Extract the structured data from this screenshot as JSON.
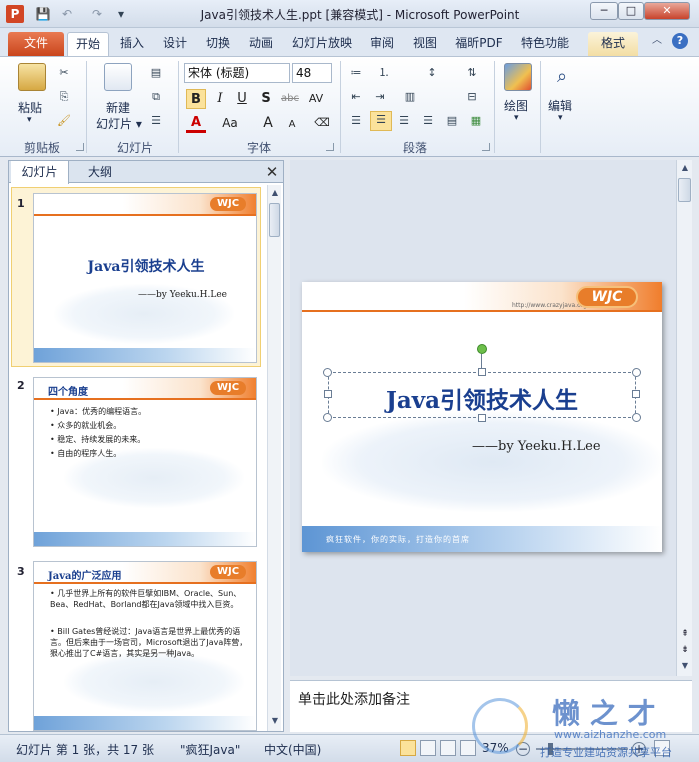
{
  "window": {
    "title": "Java引领技术人生.ppt [兼容模式] - Microsoft PowerPoint",
    "minimize": "─",
    "maximize": "□",
    "close": "✕"
  },
  "qat": {
    "save_icon": "💾",
    "undo_icon": "↶",
    "redo_icon": "↷",
    "dropdown_icon": "▾"
  },
  "tabs": [
    {
      "label": "文件"
    },
    {
      "label": "开始"
    },
    {
      "label": "插入"
    },
    {
      "label": "设计"
    },
    {
      "label": "切换"
    },
    {
      "label": "动画"
    },
    {
      "label": "幻灯片放映"
    },
    {
      "label": "审阅"
    },
    {
      "label": "视图"
    },
    {
      "label": "福昕PDF"
    },
    {
      "label": "特色功能"
    },
    {
      "label": "格式"
    }
  ],
  "ribbon": {
    "clipboard": {
      "label": "剪贴板",
      "paste": "粘贴"
    },
    "slides": {
      "label": "幻灯片",
      "new_slide_line1": "新建",
      "new_slide_line2": "幻灯片 ▾"
    },
    "font": {
      "label": "字体",
      "font_name": "宋体 (标题)",
      "font_size": "48"
    },
    "paragraph": {
      "label": "段落"
    },
    "drawing": {
      "label": "绘图"
    },
    "editing": {
      "label": "编辑"
    }
  },
  "left_panel": {
    "tab_slides": "幻灯片",
    "tab_outline": "大纲",
    "close": "✕"
  },
  "thumbnails": [
    {
      "number": "1",
      "title": "Java引领技术人生",
      "subtitle": "——by Yeeku.H.Lee",
      "bullets": []
    },
    {
      "number": "2",
      "title": "四个角度",
      "subtitle": "",
      "bullets": [
        "Java：优秀的编程语言。",
        "众多的就业机会。",
        "稳定、持续发展的未来。",
        "自由的程序人生。"
      ]
    },
    {
      "number": "3",
      "title": "Java的广泛应用",
      "subtitle": "",
      "bullets": [
        "几乎世界上所有的软件巨擘如IBM、Oracle、Sun、Bea、RedHat、Borland都在Java领域中找入巨资。",
        "Bill Gates曾经说过：Java语言是世界上最优秀的语言。但后来由于一场官司，Microsoft退出了Java阵营，狠心推出了C#语言，其实是另一种Java。"
      ]
    }
  ],
  "main_slide": {
    "title": "Java引领技术人生",
    "subtitle": "——by Yeeku.H.Lee",
    "url": "http://www.crazyjava.org",
    "logo": "WJC",
    "footer": "疯狂软件，你的实际，打造你的首席"
  },
  "notes": {
    "placeholder": "单击此处添加备注"
  },
  "status": {
    "slide_info": "幻灯片 第 1 张，共 17 张",
    "theme": "\"疯狂Java\"",
    "language": "中文(中国)",
    "zoom": "37%"
  },
  "watermark": {
    "text": "懒 之 才",
    "url": "www.aizhanzhe.com",
    "tagline": "打造专业建站资源共享平台"
  }
}
